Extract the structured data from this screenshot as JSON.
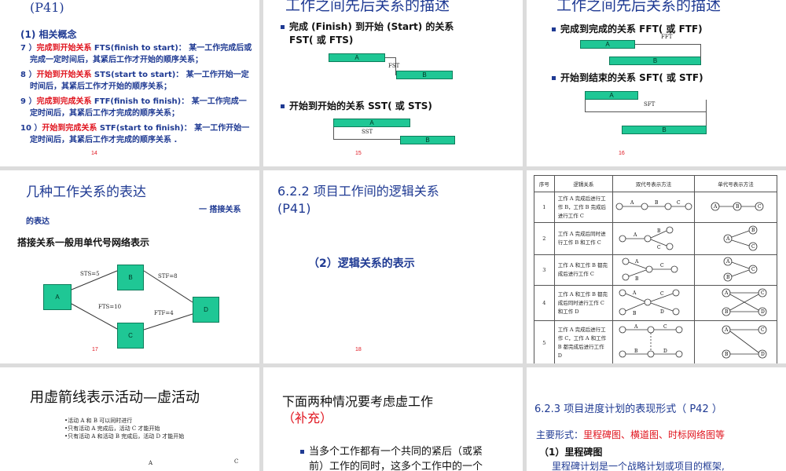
{
  "slides": {
    "s14": {
      "header": "(P41)",
      "heading": "(1) 相关概念",
      "definitions": [
        {
          "num": "7 ）",
          "term": "完成到开始关系",
          "text": " FTS(finish to start)： 某一工作完成后或完成一定时间后，其紧后工作才开始的顺序关系；"
        },
        {
          "num": "8 ）",
          "term": "开始到开始关系",
          "text": " STS(start to start)： 某一工作开始一定时间后，其紧后工作才开始的顺序关系；"
        },
        {
          "num": "9 ）",
          "term": "完成到完成关系",
          "text": " FTF(finish to finish)： 某一工作完成一定时间后，其紧后工作才完成的顺序关系；"
        },
        {
          "num": "10 ）",
          "term": "开始到完成关系",
          "text": " STF(start to finish)： 某一工作开始一定时间后，其紧后工作才完成的顺序关系 ."
        }
      ],
      "page": "14"
    },
    "s15": {
      "title": "工作之间先后关系的描述",
      "bullet1": {
        "prefix": "完成 (Finish) 到开始 (Start) 的关系",
        "suffix": "FST( 或 FTS)"
      },
      "diagram1": {
        "a": "A",
        "b": "B",
        "label": "FST"
      },
      "bullet2": "开始到开始的关系 SST( 或 STS)",
      "diagram2": {
        "a": "A",
        "b": "B",
        "label": "SST"
      },
      "page": "15"
    },
    "s16": {
      "title": "工作之间先后关系的描述",
      "bullet1": "完成到完成的关系 FFT( 或 FTF)",
      "diagram1": {
        "a": "A",
        "b": "B",
        "label": "FFT"
      },
      "bullet2": "开始到结束的关系 SFT( 或 STF)",
      "diagram2": {
        "a": "A",
        "b": "B",
        "label": "SFT"
      },
      "page": "16"
    },
    "s17": {
      "title": "几种工作关系的表达",
      "subtitle_right": "一 搭接关系",
      "subtitle_wrap": "的表达",
      "note": "搭接关系一般用单代号网络表示",
      "nodes": {
        "a": "A",
        "b": "B",
        "c": "C",
        "d": "D"
      },
      "edges": {
        "ab": "STS=5",
        "bd": "STF=8",
        "ac": "FTS=10",
        "cd": "FTF=4"
      },
      "page": "17"
    },
    "s18": {
      "title_line1": "6.2.2  项目工作间的逻辑关系",
      "title_line2": "(P41)",
      "subtitle": "（2）逻辑关系的表示",
      "page": "18"
    },
    "s19": {
      "headers": {
        "num": "序号",
        "logic": "逻辑关系",
        "double": "双代号表示方法",
        "single": "单代号表示方法"
      },
      "rows": [
        {
          "num": "1",
          "text": "工作 A 完成后进行工作 B，工作 B 完成后进行工作 C"
        },
        {
          "num": "2",
          "text": "工作 A 完成后同时进行工作 B 和工作 C"
        },
        {
          "num": "3",
          "text": "工作 A 和工作 B 都完成后进行工作 C"
        },
        {
          "num": "4",
          "text": "工作 A 和工作 B 都完成后同时进行工作 C 和工作 D"
        },
        {
          "num": "5",
          "text": "工作 A 完成后进行工作 C，工作 A 和工作 B 都完成后进行工作 D"
        }
      ],
      "letters": {
        "a": "A",
        "b": "B",
        "c": "C",
        "d": "D"
      }
    },
    "s20": {
      "title": "用虚箭线表示活动—虚活动",
      "lines": [
        "•活动 A 和 B 可以同时进行",
        "•只有活动 A 完成后，活动 C 才能开始",
        "•只有活动 A 和活动 B 完成后，活动 D 才能开始"
      ],
      "node_a": "A",
      "node_c": "C"
    },
    "s21": {
      "title": "下面两种情况要考虑虚工作",
      "title_red": "（补充）",
      "bullet_line1": "当多个工作都有一个共同的紧后（或紧",
      "bullet_line2": "前）工作的同时，这多个工作中的一个"
    },
    "s22": {
      "title": "6.2.3  项目进度计划的表现形式（ P42 ）",
      "forms_prefix": "主要形式：",
      "forms_red": "里程碑图、横道图、时标网络图等",
      "sub": "（1）里程碑图",
      "body": "里程碑计划是一个战略计划或项目的框架,"
    }
  },
  "colors": {
    "accent_blue": "#1f3a93",
    "accent_red": "#e0141e",
    "bar_teal": "#1fc795",
    "gutter": "#dcdcdc"
  }
}
